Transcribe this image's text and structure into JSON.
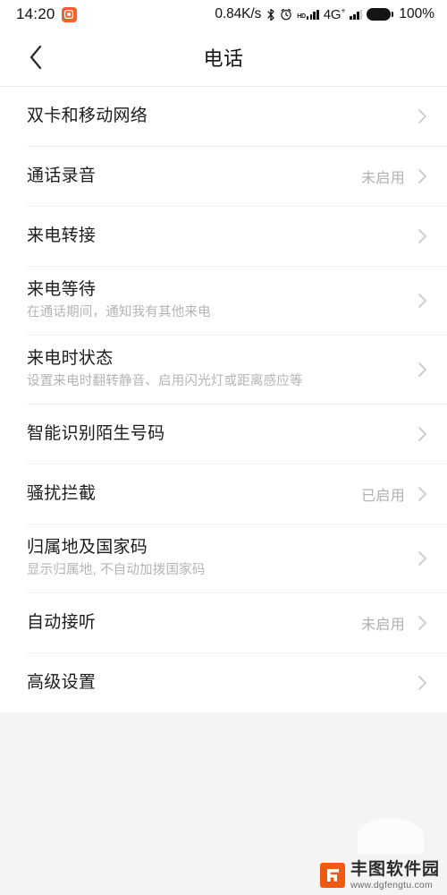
{
  "status_bar": {
    "time": "14:20",
    "app_badge_icon": "orange-app-icon",
    "network_speed": "0.84K/s",
    "bluetooth_icon": "bluetooth-icon",
    "alarm_icon": "alarm-clock-icon",
    "hd_label": "HD",
    "signal_icon_1": "signal-bars-icon",
    "network_type": "4G",
    "network_type_sup": "+",
    "signal_icon_2": "signal-bars-icon",
    "battery_icon": "battery-full-icon",
    "battery_percent": "100%"
  },
  "app_bar": {
    "back_icon": "back-chevron-icon",
    "title": "电话"
  },
  "list": {
    "chevron_icon": "chevron-right-icon",
    "items": [
      {
        "title": "双卡和移动网络",
        "sub": "",
        "value": ""
      },
      {
        "title": "通话录音",
        "sub": "",
        "value": "未启用"
      },
      {
        "title": "来电转接",
        "sub": "",
        "value": ""
      },
      {
        "title": "来电等待",
        "sub": "在通话期间，通知我有其他来电",
        "value": ""
      },
      {
        "title": "来电时状态",
        "sub": "设置来电时翻转静音、启用闪光灯或距离感应等",
        "value": ""
      },
      {
        "title": "智能识别陌生号码",
        "sub": "",
        "value": ""
      },
      {
        "title": "骚扰拦截",
        "sub": "",
        "value": "已启用"
      },
      {
        "title": "归属地及国家码",
        "sub": "显示归属地, 不自动加拨国家码",
        "value": ""
      },
      {
        "title": "自动接听",
        "sub": "",
        "value": "未启用"
      },
      {
        "title": "高级设置",
        "sub": "",
        "value": ""
      }
    ]
  },
  "watermark": {
    "logo_icon": "fengtu-logo-icon",
    "name": "丰图软件园",
    "url": "www.dgfengtu.com"
  },
  "colors": {
    "accent": "#f4622a",
    "watermark_orange": "#ef5a13",
    "page_bg": "#f4f4f4",
    "surface": "#ffffff",
    "title_text": "#1c1c1c",
    "sub_text": "#b4b4b4",
    "value_text": "#b0b0b0",
    "divider": "#efefef"
  }
}
